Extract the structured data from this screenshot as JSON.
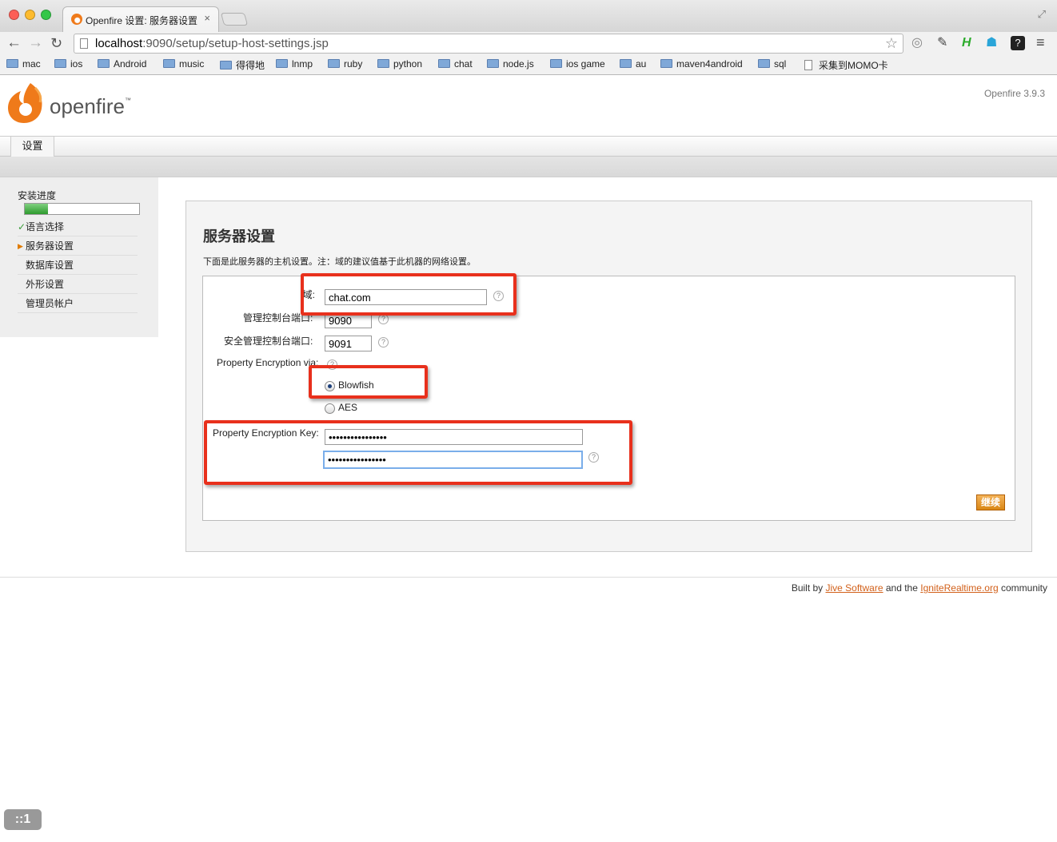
{
  "browser": {
    "tab_title": "Openfire 设置: 服务器设置",
    "tab_close": "×",
    "url_host": "localhost",
    "url_rest": ":9090/setup/setup-host-settings.jsp",
    "bookmarks": [
      "mac",
      "ios",
      "Android",
      "music",
      "得得地",
      "lnmp",
      "ruby",
      "python",
      "chat",
      "node.js",
      "ios game",
      "au",
      "maven4android",
      "sql",
      "采集到MOMO卡"
    ]
  },
  "header": {
    "logo_text": "openfire",
    "logo_tm": "™",
    "version": "Openfire 3.9.3"
  },
  "topnav": {
    "tab_label": "设置"
  },
  "sidebar": {
    "title": "安装进度",
    "progress": 0.2,
    "items": [
      {
        "label": "语言选择",
        "state": "done"
      },
      {
        "label": "服务器设置",
        "state": "current"
      },
      {
        "label": "数据库设置",
        "state": "pending"
      },
      {
        "label": "外形设置",
        "state": "pending"
      },
      {
        "label": "管理员帐户",
        "state": "pending"
      }
    ]
  },
  "main": {
    "title": "服务器设置",
    "description": "下面是此服务器的主机设置。注：域的建议值基于此机器的网络设置。",
    "form": {
      "domain_label": "域:",
      "domain_value": "chat.com",
      "admin_port_label": "管理控制台端口:",
      "admin_port_value": "9090",
      "secure_port_label": "安全管理控制台端口:",
      "secure_port_value": "9091",
      "encryption_label": "Property Encryption via:",
      "option_blowfish": "Blowfish",
      "option_aes": "AES",
      "selected_option": "Blowfish",
      "key_label": "Property Encryption Key:",
      "key_value": "••••••••••••••••",
      "key_confirm_value": "••••••••••••••••",
      "help_glyph": "?",
      "continue_label": "继续"
    }
  },
  "footer": {
    "prefix": "Built by ",
    "link1": "Jive Software",
    "middle": " and the ",
    "link2": "IgniteRealtime.org",
    "suffix": " community"
  },
  "badge": {
    "label": "::1"
  },
  "colors": {
    "highlight": "#e8301c",
    "brand_orange": "#ef7a1a",
    "link": "#d2601a"
  }
}
